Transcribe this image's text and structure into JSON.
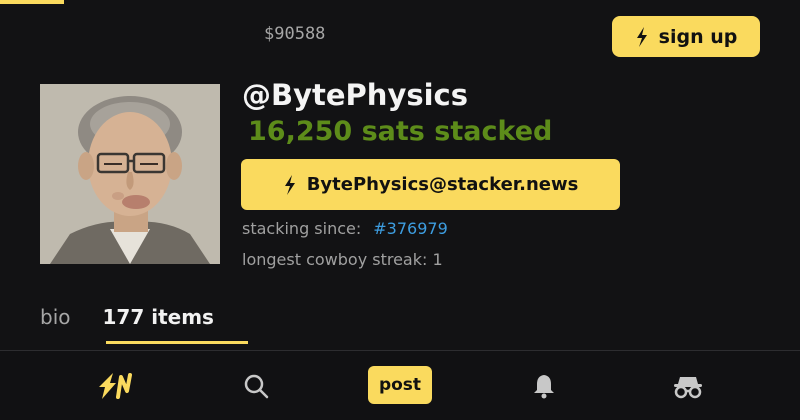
{
  "header": {
    "price": "$90588",
    "signup_label": "sign up"
  },
  "profile": {
    "username": "@BytePhysics",
    "sats_stacked": "16,250 sats stacked",
    "lightning_address": "BytePhysics@stacker.news",
    "stacking_since_label": "stacking since:",
    "stacking_since_item": "#376979",
    "longest_streak": "longest cowboy streak: 1"
  },
  "tabs": [
    {
      "label": "bio",
      "active": false
    },
    {
      "label": "177 items",
      "active": true
    }
  ],
  "bottom_nav": {
    "logo": "SN",
    "post_label": "post",
    "icons": [
      "sn-logo-icon",
      "search-icon",
      "bell-icon",
      "anon-incognito-icon"
    ]
  },
  "colors": {
    "accent": "#fada5e",
    "sats_green": "#5d8c1a",
    "link_blue": "#3d9de0",
    "background": "#121214"
  }
}
